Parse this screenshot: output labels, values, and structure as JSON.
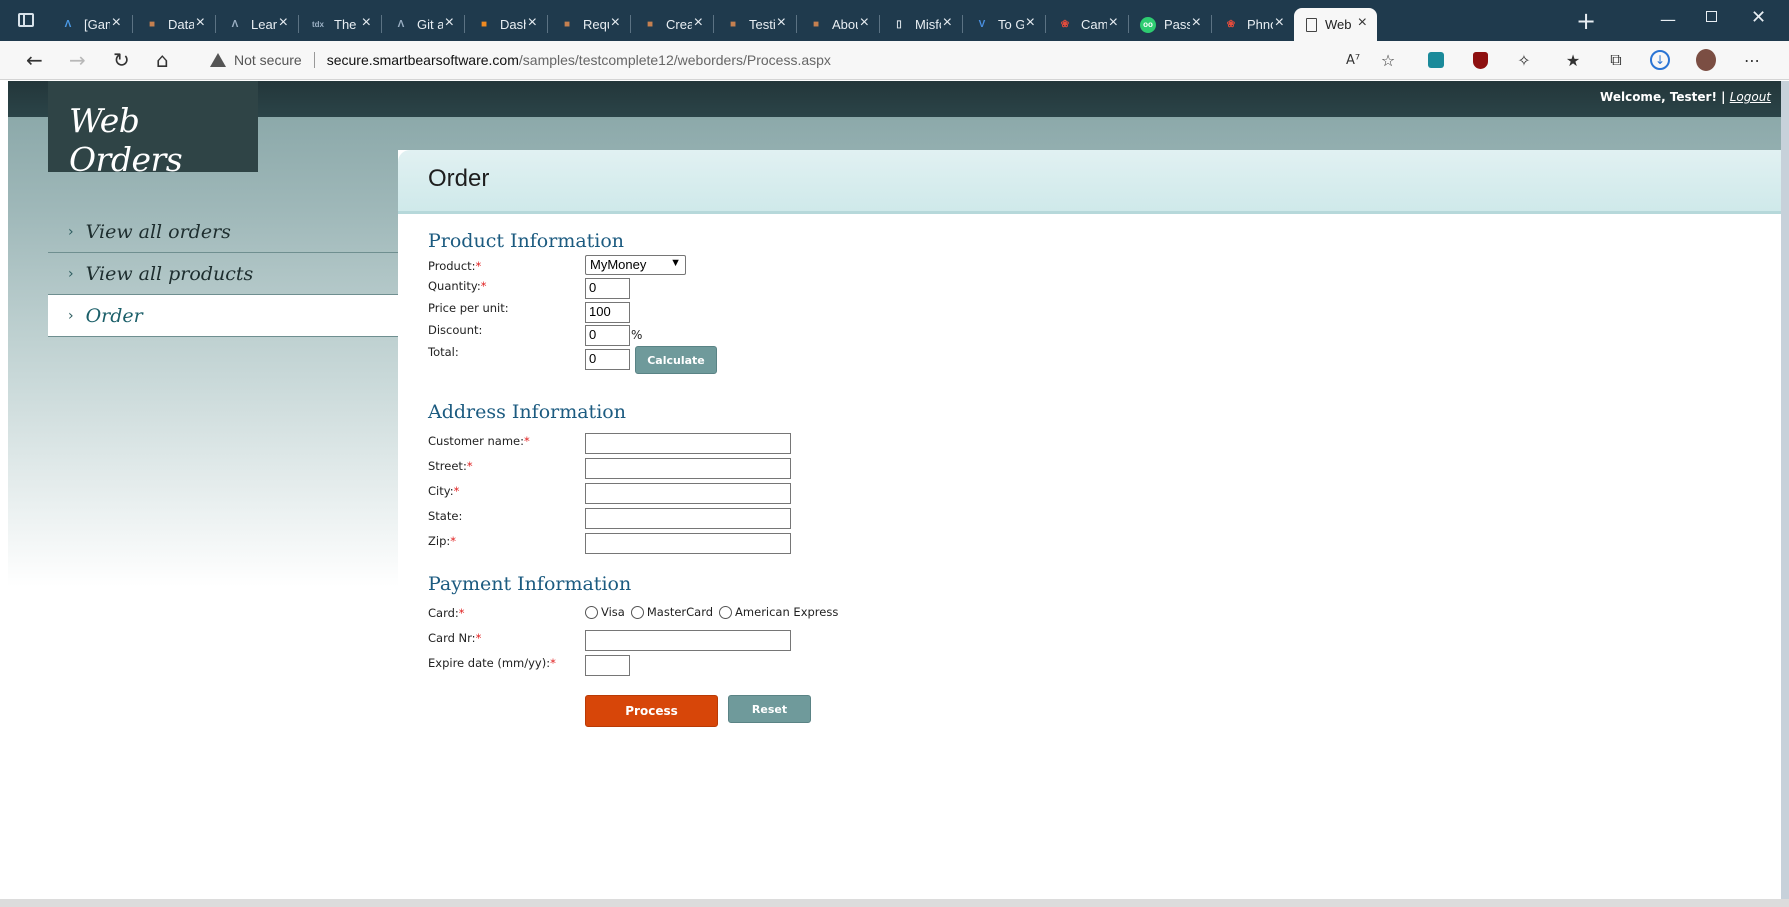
{
  "browser": {
    "tabs": [
      {
        "label": "[Gam",
        "icon": "A",
        "color": "#1f6fd1"
      },
      {
        "label": "Data-",
        "icon": "■",
        "color": "#8a5a3a"
      },
      {
        "label": "Learn",
        "icon": "A",
        "color": "#3c4f66"
      },
      {
        "label": "The e",
        "icon": "tdx",
        "color": "#3a4e62"
      },
      {
        "label": "Git ar",
        "icon": "A",
        "color": "#3c4f66"
      },
      {
        "label": "Dashl",
        "icon": "■",
        "color": "#e07010"
      },
      {
        "label": "Requ",
        "icon": "■",
        "color": "#8a5a3a"
      },
      {
        "label": "Creat",
        "icon": "■",
        "color": "#8a5a3a"
      },
      {
        "label": "Testin",
        "icon": "■",
        "color": "#8a5a3a"
      },
      {
        "label": "Abou",
        "icon": "■",
        "color": "#8a5a3a"
      },
      {
        "label": "Misfc",
        "icon": "▯",
        "color": "#1f3a4d"
      },
      {
        "label": "To Gc",
        "icon": "V",
        "color": "#2a7bd4"
      },
      {
        "label": "Caml",
        "icon": "❀",
        "color": "#c0392b"
      },
      {
        "label": "Passp",
        "icon": "oo",
        "color": "#2ecc71"
      },
      {
        "label": "Phno",
        "icon": "❀",
        "color": "#c0392b"
      },
      {
        "label": "Web",
        "icon": "▯",
        "color": "#f7f7f7"
      }
    ],
    "not_secure": "Not secure",
    "url_host": "secure.smartbearsoftware.com",
    "url_path": "/samples/testcomplete12/weborders/Process.aspx"
  },
  "header": {
    "welcome": "Welcome, Tester! |",
    "logout": "Logout"
  },
  "logo": "Web Orders",
  "menu": [
    {
      "label": "View all orders"
    },
    {
      "label": "View all products"
    },
    {
      "label": "Order"
    }
  ],
  "page_title": "Order",
  "product": {
    "title": "Product Information",
    "product_label": "Product:",
    "product_value": "MyMoney",
    "quantity_label": "Quantity:",
    "quantity_value": "0",
    "price_label": "Price per unit:",
    "price_value": "100",
    "discount_label": "Discount:",
    "discount_value": "0",
    "percent": "%",
    "total_label": "Total:",
    "total_value": "0",
    "calculate": "Calculate"
  },
  "address": {
    "title": "Address Information",
    "customer_label": "Customer name:",
    "street_label": "Street:",
    "city_label": "City:",
    "state_label": "State:",
    "zip_label": "Zip:"
  },
  "payment": {
    "title": "Payment Information",
    "card_label": "Card:",
    "cards": [
      "Visa",
      "MasterCard",
      "American Express"
    ],
    "card_nr_label": "Card Nr:",
    "expire_label": "Expire date (mm/yy):"
  },
  "actions": {
    "process": "Process",
    "reset": "Reset"
  },
  "required_mark": "*"
}
